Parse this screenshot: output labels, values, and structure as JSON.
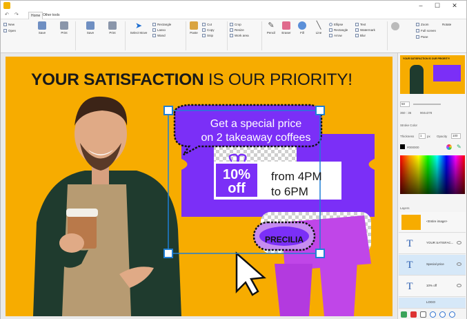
{
  "window": {
    "minimize": "–",
    "maximize": "☐",
    "close": "✕"
  },
  "tabs": [
    "Home",
    "Other tools"
  ],
  "quick_access": {
    "undo": "↶",
    "redo": "↷"
  },
  "ribbon": {
    "new_label": "New",
    "open_label": "Open",
    "save_label": "Save",
    "print_label": "Print",
    "save2_label": "Save",
    "print2_label": "Print",
    "select_move_label": "Select Move",
    "rectangle_label": "Rectangle",
    "lasso_label": "Lasso",
    "wand_label": "Wand",
    "paste_label": "Paste",
    "cut_label": "Cut",
    "copy_label": "Copy",
    "snip_label": "Snip",
    "crop_label": "Crop",
    "resize_label": "Resize",
    "work_area_label": "Work area",
    "pencil_label": "Pencil",
    "eraser_label": "Eraser",
    "fill_label": "Fill",
    "line_label": "Line",
    "ellipse_label": "Ellipse",
    "rect_shape_label": "Rectangle",
    "arrow_label": "Arrow",
    "text_label": "Text",
    "watermark_label": "Watermark",
    "blur_label": "Blur",
    "zoom_label": "Zoom",
    "rotate_label": "Rotate",
    "full_screen_label": "Full screen",
    "pane_label": "Pane"
  },
  "poster": {
    "headline_bold": "YOUR SATISFACTION",
    "headline_rest": " IS OUR PRIORITY!",
    "bubble_line1": "Get a special price",
    "bubble_line2": "on 2 takeaway coffees",
    "discount_big": "10%",
    "discount_small": "off",
    "time_line1": "from 4PM",
    "time_line2": "to 6PM",
    "logo_text": "PRECILIA"
  },
  "panel": {
    "preview_title": "YOUR SATISFACTION IS OUR PRIORITY!",
    "zoom_value": "50",
    "size_value": "360 : 36",
    "pos_value": "904x378",
    "stroke_color_label": "Stroke Color",
    "thickness_label": "Thickness",
    "thickness_value": "1",
    "px_label": "px",
    "opacity_label": "Opacity",
    "opacity_value": "100",
    "hex_value": "#000000",
    "layers_label": "Layers",
    "layers": [
      {
        "name": "<Entire image>",
        "icon": ""
      },
      {
        "name": "YOUR SATISFAC...",
        "icon": "T"
      },
      {
        "name": "Special price",
        "icon": "T"
      },
      {
        "name": "10% off",
        "icon": "T"
      },
      {
        "name": "LOGO",
        "icon": ""
      }
    ]
  },
  "colors": {
    "poster_bg": "#f7ac00",
    "purple": "#7b2ff7",
    "accent": "#1f7fd6"
  }
}
